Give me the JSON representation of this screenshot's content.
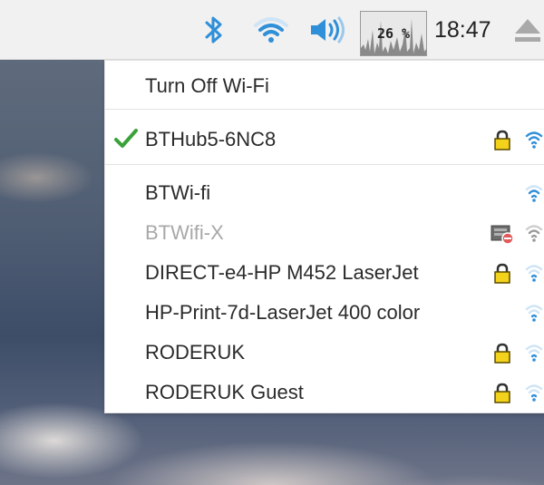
{
  "taskbar": {
    "cpu_value": "26",
    "cpu_unit": "%",
    "clock": "18:47",
    "icons": [
      "bluetooth-icon",
      "wifi-icon",
      "volume-icon",
      "cpu-monitor",
      "eject-icon"
    ]
  },
  "colors": {
    "accent_blue": "#2f8fd8",
    "check_green": "#3aa23a",
    "lock_yellow": "#f2d21a"
  },
  "menu": {
    "turn_off": "Turn Off Wi-Fi",
    "connected": {
      "ssid": "BTHub5-6NC8",
      "secured": true
    },
    "networks": [
      {
        "ssid": "BTWi-fi",
        "secured": false,
        "enabled": true
      },
      {
        "ssid": "BTWifi-X",
        "secured": false,
        "enabled": false
      },
      {
        "ssid": "DIRECT-e4-HP M452 LaserJet",
        "secured": true,
        "enabled": true
      },
      {
        "ssid": "HP-Print-7d-LaserJet 400 color",
        "secured": false,
        "enabled": true
      },
      {
        "ssid": "RODERUK",
        "secured": true,
        "enabled": true
      },
      {
        "ssid": "RODERUK Guest",
        "secured": true,
        "enabled": true
      }
    ]
  }
}
